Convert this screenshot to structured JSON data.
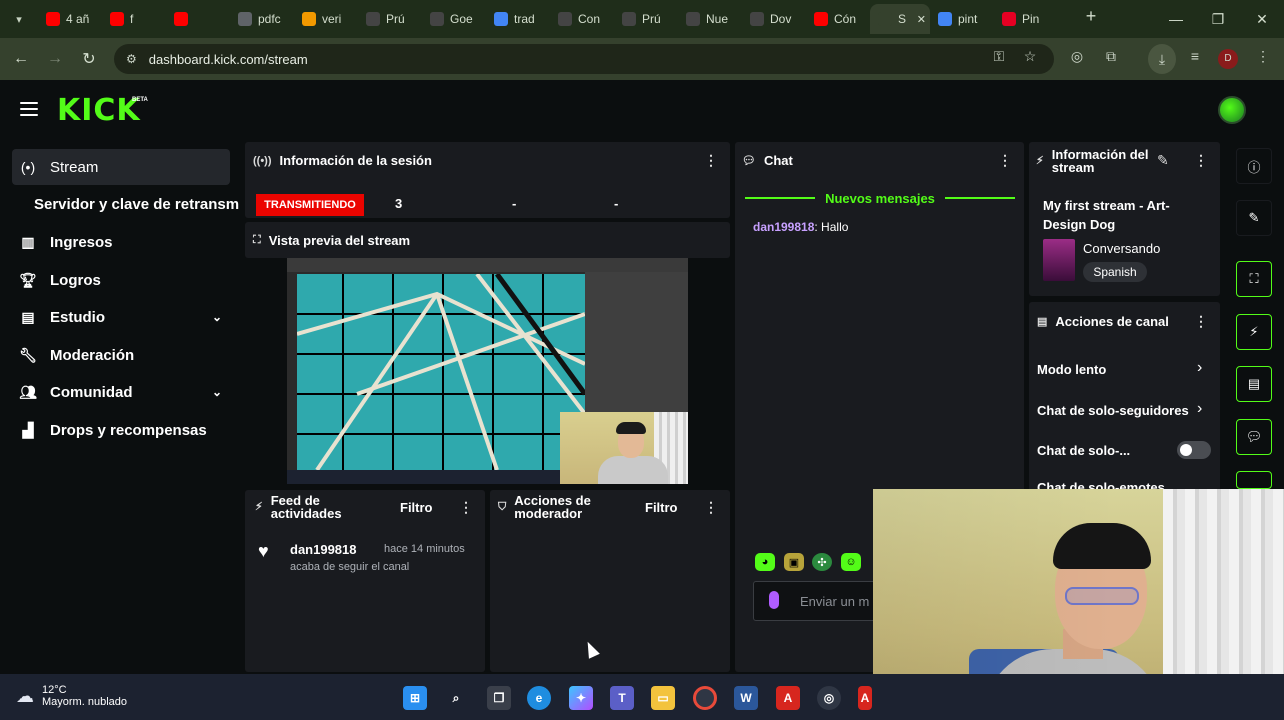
{
  "browser": {
    "tabs": [
      {
        "label": "4 añ",
        "favicon": "youtube-icon",
        "color": "#ff0000"
      },
      {
        "label": "f",
        "favicon": "youtube-icon",
        "color": "#ff0000"
      },
      {
        "label": "",
        "favicon": "youtube-icon",
        "color": "#ff0000"
      },
      {
        "label": "pdfc",
        "favicon": "globe-icon",
        "color": "#5f6368"
      },
      {
        "label": "veri",
        "favicon": "pen-icon",
        "color": "#f29900"
      },
      {
        "label": "Prú",
        "favicon": "openai-icon",
        "color": "#444"
      },
      {
        "label": "Goe",
        "favicon": "openai-icon",
        "color": "#444"
      },
      {
        "label": "trad",
        "favicon": "google-icon",
        "color": "#4285f4"
      },
      {
        "label": "Con",
        "favicon": "openai-icon",
        "color": "#444"
      },
      {
        "label": "Prú",
        "favicon": "openai-icon",
        "color": "#444"
      },
      {
        "label": "Nue",
        "favicon": "globe-icon",
        "color": "#444"
      },
      {
        "label": "Dov",
        "favicon": "globe-icon",
        "color": "#444"
      },
      {
        "label": "Cón",
        "favicon": "youtube-icon",
        "color": "#ff0000"
      },
      {
        "label": "S",
        "favicon": "speaker-icon",
        "color": "#35412d"
      },
      {
        "label": "pint",
        "favicon": "google-icon",
        "color": "#4285f4"
      },
      {
        "label": "Pin",
        "favicon": "pinterest-icon",
        "color": "#e60023"
      }
    ],
    "url": "dashboard.kick.com/stream",
    "profile_initial": "D"
  },
  "kick": {
    "logo": "KICK",
    "beta": "BETA",
    "brand_color": "#53fc18"
  },
  "sidebar": {
    "items": [
      {
        "label": "Stream",
        "icon": "broadcast-icon"
      },
      {
        "label": "Ingresos",
        "icon": "chart-icon"
      },
      {
        "label": "Logros",
        "icon": "trophy-icon"
      },
      {
        "label": "Estudio",
        "icon": "studio-icon"
      },
      {
        "label": "Moderación",
        "icon": "wrench-icon"
      },
      {
        "label": "Comunidad",
        "icon": "users-icon"
      },
      {
        "label": "Drops y recompensas",
        "icon": "drops-icon"
      }
    ],
    "sub_item": "Servidor y clave de retransm"
  },
  "session": {
    "title": "Información de la sesión",
    "status": "TRANSMITIENDO",
    "viewers": "3",
    "stat2": "-",
    "stat3": "-"
  },
  "preview": {
    "title": "Vista previa del stream"
  },
  "feed": {
    "title": "Feed de actividades",
    "filter": "Filtro",
    "entry_user": "dan199818",
    "entry_time": "hace 14 minutos",
    "entry_desc": "acaba de seguir el canal"
  },
  "mod": {
    "title": "Acciones de moderador",
    "filter": "Filtro"
  },
  "chat": {
    "title": "Chat",
    "new_messages": "Nuevos mensajes",
    "message_user": "dan199818",
    "message_text": ": Hallo",
    "input_placeholder": "Enviar un m"
  },
  "stream_info": {
    "title": "Información del stream",
    "stream_title": "My first stream - Art-Design Dog",
    "category": "Conversando",
    "language": "Spanish"
  },
  "channel_actions": {
    "title": "Acciones de canal",
    "rows": [
      {
        "label": "Modo lento"
      },
      {
        "label": "Chat de solo-seguidores"
      },
      {
        "label": "Chat de solo-..."
      },
      {
        "label": "Chat de solo-emotes"
      }
    ]
  },
  "taskbar": {
    "temp": "12°C",
    "weather": "Mayorm. nublado"
  }
}
